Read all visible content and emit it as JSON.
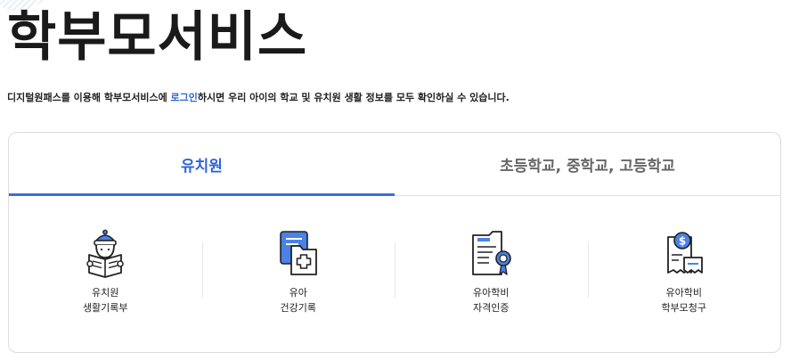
{
  "page": {
    "title": "학부모서비스",
    "intro": {
      "before": "디지털원패스를 이용해 학부모서비스에 ",
      "link": "로그인",
      "after": "하시면 우리 아이의 학교 및 유치원 생활 정보를 모두 확인하실 수 있습니다."
    }
  },
  "tabs": [
    {
      "label": "유치원",
      "active": true
    },
    {
      "label": "초등학교, 중학교, 고등학교",
      "active": false
    }
  ],
  "services": [
    {
      "line1": "유치원",
      "line2": "생활기록부",
      "icon": "reading-child-icon"
    },
    {
      "line1": "유아",
      "line2": "건강기록",
      "icon": "health-record-icon"
    },
    {
      "line1": "유아학비",
      "line2": "자격인증",
      "icon": "certificate-icon"
    },
    {
      "line1": "유아학비",
      "line2": "학부모청구",
      "icon": "billing-icon"
    }
  ],
  "colors": {
    "accent": "#2f66d4",
    "icon_blue": "#4a82e8",
    "text": "#222222",
    "border": "#dcdcdc"
  }
}
